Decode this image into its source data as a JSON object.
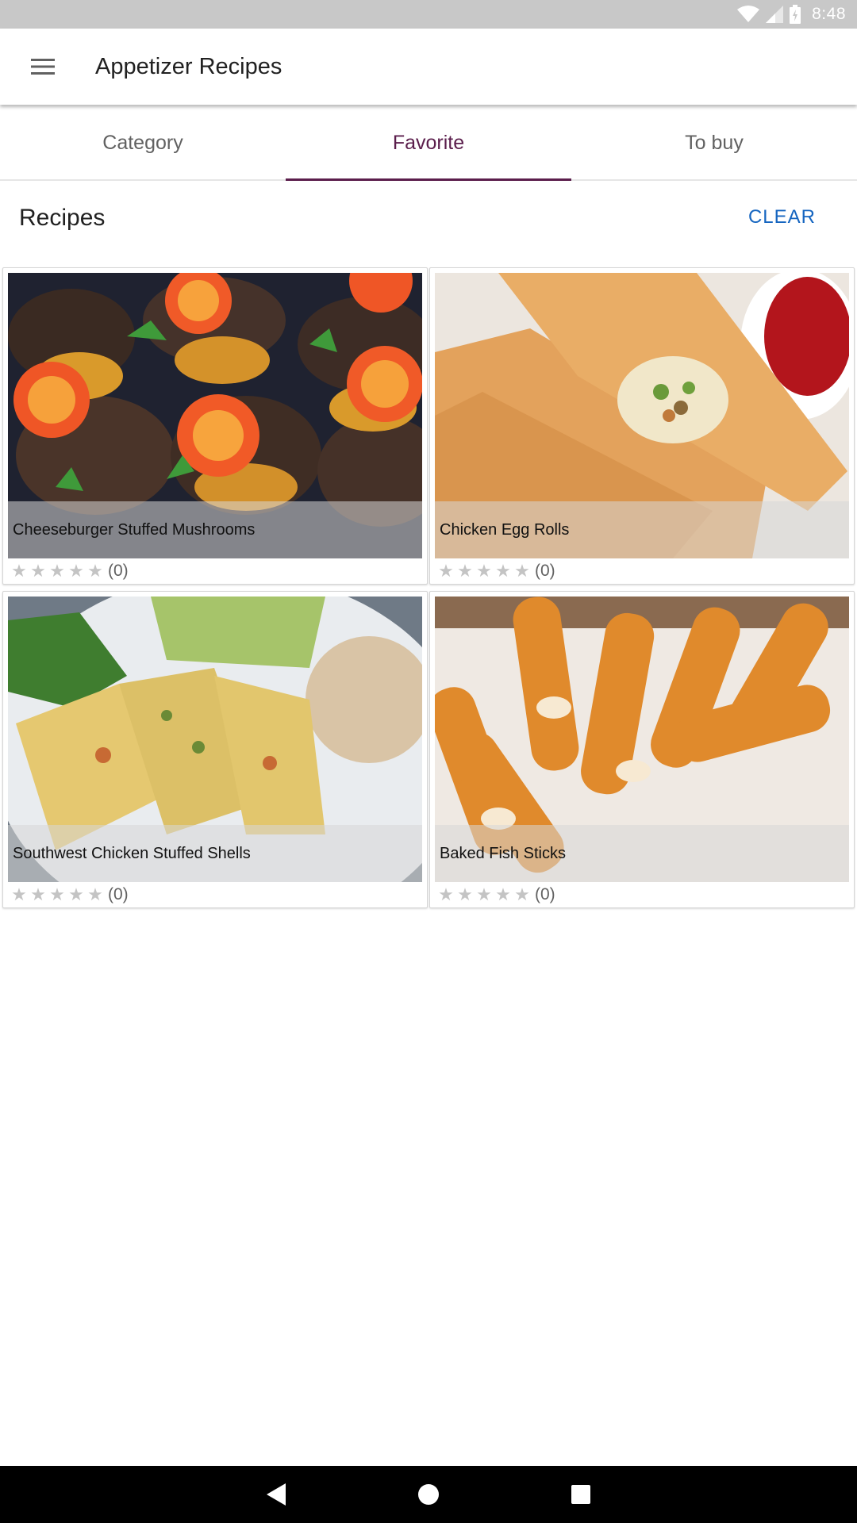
{
  "status_bar": {
    "time": "8:48",
    "icons": [
      "wifi-icon",
      "cell-signal-icon",
      "battery-icon"
    ]
  },
  "app_bar": {
    "title": "Appetizer Recipes",
    "menu_icon": "hamburger-menu-icon"
  },
  "tabs": [
    {
      "label": "Category",
      "active": false
    },
    {
      "label": "Favorite",
      "active": true
    },
    {
      "label": "To buy",
      "active": false
    }
  ],
  "section": {
    "title": "Recipes",
    "clear_label": "CLEAR"
  },
  "recipes": [
    {
      "name": "Cheeseburger Stuffed Mushrooms",
      "rating_count": "(0)",
      "stars": 0
    },
    {
      "name": "Chicken Egg Rolls",
      "rating_count": "(0)",
      "stars": 0
    },
    {
      "name": "Southwest Chicken Stuffed Shells",
      "rating_count": "(0)",
      "stars": 0
    },
    {
      "name": "Baked Fish Sticks",
      "rating_count": "(0)",
      "stars": 0
    }
  ],
  "nav_bar": {
    "buttons": [
      "back-icon",
      "home-icon",
      "recents-icon"
    ]
  },
  "colors": {
    "accent": "#5b1e4c",
    "link": "#1565c0",
    "status_bar": "#c8c8c8"
  }
}
